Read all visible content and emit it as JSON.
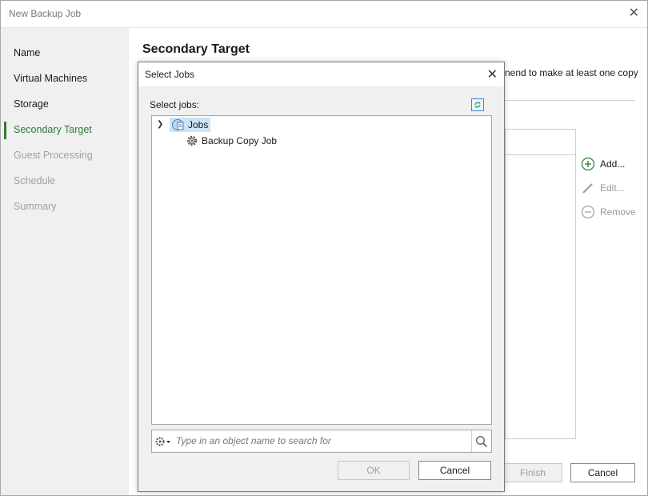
{
  "window": {
    "title": "New Backup Job",
    "close_glyph": "✕"
  },
  "sidebar": {
    "steps": [
      {
        "label": "Name"
      },
      {
        "label": "Virtual Machines"
      },
      {
        "label": "Storage"
      },
      {
        "label": "Secondary Target"
      },
      {
        "label": "Guest Processing"
      },
      {
        "label": "Schedule"
      },
      {
        "label": "Summary"
      }
    ],
    "active_step": "Secondary Target",
    "active_color": "#2e7d32"
  },
  "main": {
    "title": "Secondary Target",
    "description_fragment": "nend to make at least one copy",
    "buttons": {
      "add": "Add...",
      "edit": "Edit...",
      "remove": "Remove"
    },
    "footer": {
      "finish": "Finish",
      "cancel": "Cancel"
    }
  },
  "dialog": {
    "title": "Select Jobs",
    "label": "Select jobs:",
    "tree": {
      "root": {
        "label": "Jobs",
        "icon": "jobs-folder-icon",
        "selected": true
      },
      "children": [
        {
          "label": "Backup Copy Job",
          "icon": "gear-icon"
        }
      ]
    },
    "search": {
      "placeholder": "Type in an object name to search for",
      "value": ""
    },
    "ok": "OK",
    "cancel": "Cancel"
  }
}
